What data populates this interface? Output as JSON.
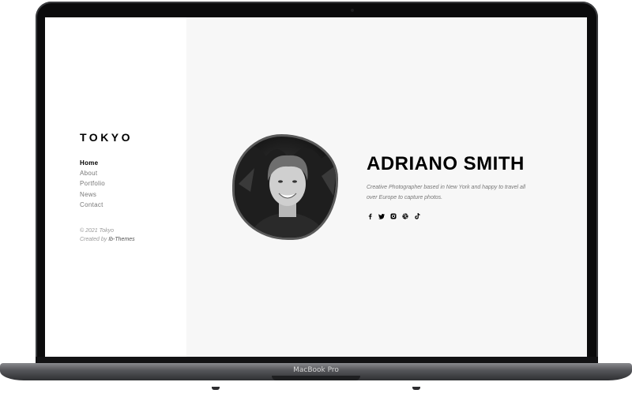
{
  "device": {
    "label": "MacBook Pro"
  },
  "site": {
    "logo": "TOKYO",
    "nav": [
      {
        "label": "Home",
        "active": true
      },
      {
        "label": "About",
        "active": false
      },
      {
        "label": "Portfolio",
        "active": false
      },
      {
        "label": "News",
        "active": false
      },
      {
        "label": "Contact",
        "active": false
      }
    ],
    "copyright": "© 2021 Tokyo",
    "created_by_prefix": "Created by",
    "created_by_author": "Ib-Themes"
  },
  "hero": {
    "name": "ADRIANO SMITH",
    "description": "Creative Photographer based in New York and happy to travel all over Europe to capture photos.",
    "socials": [
      "facebook-icon",
      "twitter-icon",
      "instagram-icon",
      "dribbble-icon",
      "tiktok-icon"
    ]
  },
  "colors": {
    "accent": "#000000",
    "muted": "#787878",
    "background": "#f7f7f7"
  }
}
